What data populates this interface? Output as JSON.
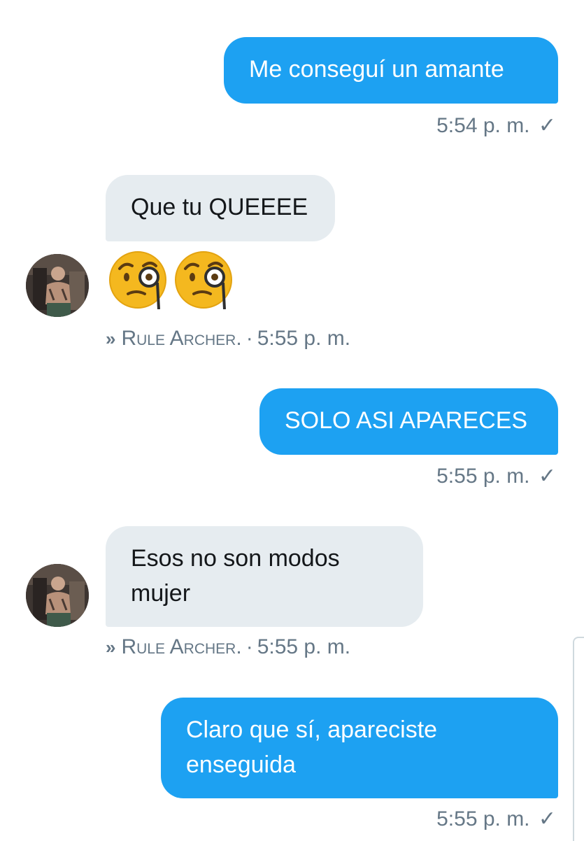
{
  "messages": [
    {
      "direction": "out",
      "text": "Me conseguí un amante",
      "time": "5:54 p. m."
    },
    {
      "direction": "in",
      "text": "Que tu QUEEEE"
    },
    {
      "direction": "in",
      "emoji": [
        "face-with-monocle",
        "face-with-monocle"
      ],
      "sender": "Rule Archer.",
      "time": "5:55 p. m."
    },
    {
      "direction": "out",
      "text": "SOLO ASI APARECES",
      "time": "5:55 p. m."
    },
    {
      "direction": "in",
      "line1": "Esos no son modos",
      "line2": "mujer",
      "sender": "Rule Archer.",
      "time": "5:55 p. m."
    },
    {
      "direction": "out",
      "line1": "Claro que sí, apareciste",
      "line2": "enseguida",
      "time": "5:55 p. m."
    }
  ],
  "read_mark": "✓",
  "separator": "·",
  "sender_icon": "»",
  "colors": {
    "outgoing_bubble": "#1da1f2",
    "incoming_bubble": "#e6ecf0",
    "meta_text": "#657786"
  }
}
